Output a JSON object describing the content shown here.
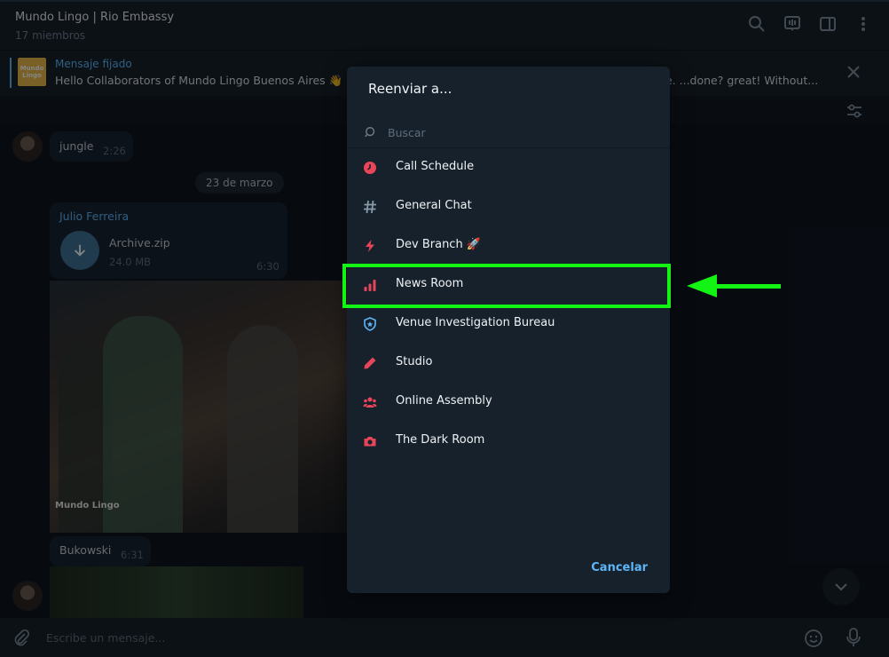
{
  "header": {
    "title": "Mundo Lingo | Rio Embassy",
    "subtitle": "17 miembros",
    "icons": [
      "search-icon",
      "live-chat-icon",
      "sidebar-toggle-icon",
      "more-vertical-icon"
    ]
  },
  "pinned": {
    "thumb_text": "Mundo Lingo",
    "title": "Mensaje fijado",
    "text": "Hello Collaborators of Mundo Lingo Buenos Aires 👋",
    "tail": "e.    ...done? great! Without..."
  },
  "messages": {
    "m1": {
      "text": "jungle",
      "time": "2:26"
    },
    "date": "23 de marzo",
    "file": {
      "sender": "Julio Ferreira",
      "name": "Archive.zip",
      "size": "24.0 MB",
      "time": "6:30"
    },
    "photo_logo": "Mundo Lingo",
    "m2": {
      "text": "Bukowski",
      "time": "6:31"
    }
  },
  "composer": {
    "placeholder": "Escribe un mensaje..."
  },
  "dialog": {
    "title": "Reenviar a...",
    "search_placeholder": "Buscar",
    "items": [
      {
        "label": "Call Schedule",
        "icon": "clock-icon",
        "color": "#e8445a"
      },
      {
        "label": "General Chat",
        "icon": "hash-icon",
        "color": "#8899a8"
      },
      {
        "label": "Dev Branch 🚀",
        "icon": "bolt-icon",
        "color": "#e8445a"
      },
      {
        "label": "News Room",
        "icon": "bar-chart-icon",
        "color": "#e8445a"
      },
      {
        "label": "Venue Investigation Bureau",
        "icon": "shield-icon",
        "color": "#5eb5f7"
      },
      {
        "label": "Studio",
        "icon": "pencil-icon",
        "color": "#e8445a"
      },
      {
        "label": "Online Assembly",
        "icon": "group-icon",
        "color": "#e8445a"
      },
      {
        "label": "The Dark Room",
        "icon": "camera-icon",
        "color": "#e8445a"
      }
    ],
    "cancel_label": "Cancelar"
  },
  "annotation": {
    "color": "#14f414",
    "target": "News Room"
  }
}
